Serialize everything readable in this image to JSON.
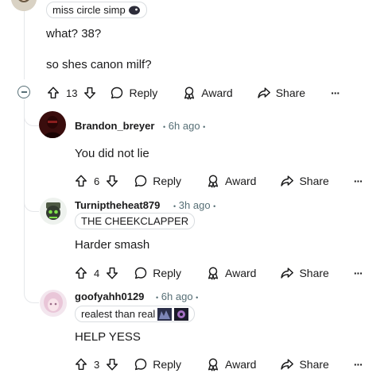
{
  "parent": {
    "flair": "miss circle simp",
    "body_lines": [
      "what? 38?",
      "so shes canon milf?"
    ],
    "votes": "13"
  },
  "actions": {
    "reply": "Reply",
    "award": "Award",
    "share": "Share",
    "more": "···"
  },
  "replies": [
    {
      "username": "Brandon_breyer",
      "time": "6h ago",
      "body": "You did not lie",
      "votes": "6",
      "flair": ""
    },
    {
      "username": "Turniptheheat879",
      "time": "3h ago",
      "flair": "THE CHEEKCLAPPER",
      "body": "Harder smash",
      "votes": "4"
    },
    {
      "username": "goofyahh0129",
      "time": "6h ago",
      "flair": "realest than real",
      "body": "HELP YESS",
      "votes": "3"
    }
  ],
  "separators": {
    "dot": "•"
  },
  "icons": {
    "upvote": "upvote-icon",
    "downvote": "downvote-icon",
    "reply": "comment-bubble-icon",
    "award": "award-ribbon-icon",
    "share": "share-arrow-icon",
    "collapse": "collapse-minus-icon"
  },
  "colors": {
    "text": "#1a1a1b",
    "meta": "#576f76",
    "line": "#e5e7ea",
    "flair_border": "#d9dde0"
  }
}
